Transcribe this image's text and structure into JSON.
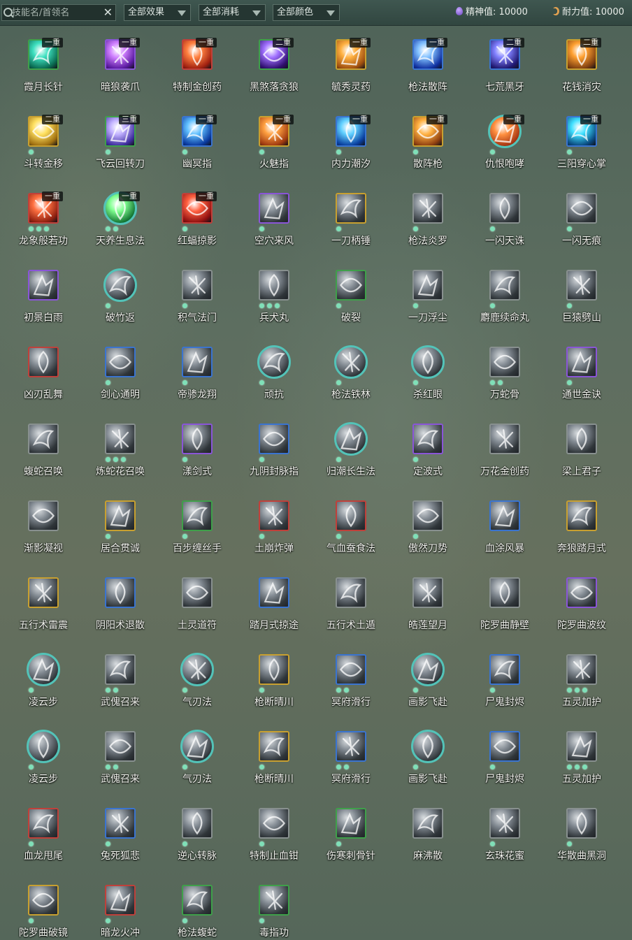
{
  "toolbar": {
    "search_placeholder": "技能名/首领名",
    "clear_icon": "✕",
    "filters": [
      {
        "label": "全部效果"
      },
      {
        "label": "全部消耗"
      },
      {
        "label": "全部颜色"
      }
    ],
    "stats": [
      {
        "text": "精神值: 10000",
        "icon": "spirit-drop-icon"
      },
      {
        "text": "耐力值: 10000",
        "icon": "stamina-moon-icon"
      }
    ]
  },
  "skills": [
    {
      "name": "霞月长针",
      "badge": "一重",
      "dots": 0,
      "frame": "c-green",
      "colors": [
        "#3ee0c0",
        "#0a6a50"
      ]
    },
    {
      "name": "暗狼袭爪",
      "badge": "一重",
      "dots": 0,
      "frame": "c-purple",
      "colors": [
        "#d080ff",
        "#5a1aa0"
      ]
    },
    {
      "name": "特制金创药",
      "badge": "一重",
      "dots": 0,
      "frame": "c-red",
      "colors": [
        "#ff8040",
        "#a02010"
      ]
    },
    {
      "name": "黑煞落贪狼",
      "badge": "二重",
      "dots": 0,
      "frame": "c-green",
      "colors": [
        "#a070ff",
        "#301070"
      ]
    },
    {
      "name": "毓秀灵药",
      "badge": "一重",
      "dots": 0,
      "frame": "c-gold",
      "colors": [
        "#ffb040",
        "#a05010"
      ]
    },
    {
      "name": "枪法散阵",
      "badge": "一重",
      "dots": 0,
      "frame": "c-blue",
      "colors": [
        "#80c0ff",
        "#1030a0"
      ]
    },
    {
      "name": "七荒黑牙",
      "badge": "二重",
      "dots": 0,
      "frame": "c-blue",
      "colors": [
        "#8080ff",
        "#201870"
      ]
    },
    {
      "name": "花钱消灾",
      "badge": "二重",
      "dots": 0,
      "frame": "c-gold",
      "colors": [
        "#ffa030",
        "#804010"
      ]
    },
    {
      "name": "斗转金移",
      "badge": "二重",
      "dots": 1,
      "frame": "c-gold",
      "colors": [
        "#ffe060",
        "#a07010"
      ]
    },
    {
      "name": "飞云回转刀",
      "badge": "三重",
      "dots": 1,
      "frame": "c-green",
      "colors": [
        "#c0b0ff",
        "#4030a0"
      ]
    },
    {
      "name": "幽冥指",
      "badge": "一重",
      "dots": 1,
      "frame": "c-blue",
      "colors": [
        "#60c0ff",
        "#0a3aa0"
      ]
    },
    {
      "name": "火魅指",
      "badge": "一重",
      "dots": 1,
      "frame": "c-gold",
      "colors": [
        "#ffa040",
        "#a03a10"
      ]
    },
    {
      "name": "内力潮汐",
      "badge": "一重",
      "dots": 1,
      "frame": "c-blue",
      "colors": [
        "#60d0ff",
        "#0a40a0"
      ]
    },
    {
      "name": "散阵枪",
      "badge": "一重",
      "dots": 1,
      "frame": "c-gold",
      "colors": [
        "#ffb040",
        "#904010"
      ]
    },
    {
      "name": "仇恨咆哮",
      "badge": "一重",
      "dots": 1,
      "frame": "c-teal",
      "round": true,
      "colors": [
        "#ff9040",
        "#a03010"
      ]
    },
    {
      "name": "三阳穿心掌",
      "badge": "一重",
      "dots": 1,
      "frame": "c-blue",
      "colors": [
        "#40e0ff",
        "#0a4a80"
      ]
    },
    {
      "name": "龙象般若功",
      "badge": "一重",
      "dots": 3,
      "frame": "c-red",
      "colors": [
        "#ff7040",
        "#902010"
      ]
    },
    {
      "name": "天养生息法",
      "badge": "一重",
      "dots": 2,
      "frame": "c-teal",
      "round": true,
      "colors": [
        "#80ff90",
        "#107030"
      ]
    },
    {
      "name": "红蝠掠影",
      "badge": "一重",
      "dots": 1,
      "frame": "c-red",
      "colors": [
        "#ff6040",
        "#901010"
      ]
    },
    {
      "name": "空穴来风",
      "dots": 1,
      "frame": "c-purple"
    },
    {
      "name": "一刀柄锤",
      "dots": 1,
      "frame": "c-gold"
    },
    {
      "name": "枪法炎罗",
      "dots": 1,
      "frame": "c-gray"
    },
    {
      "name": "一闪天诛",
      "dots": 1,
      "frame": "c-gray"
    },
    {
      "name": "一闪无痕",
      "dots": 1,
      "frame": "c-gray"
    },
    {
      "name": "初景白雨",
      "dots": 0,
      "frame": "c-purple"
    },
    {
      "name": "破竹返",
      "dots": 1,
      "frame": "c-teal",
      "round": true
    },
    {
      "name": "积气法门",
      "dots": 1,
      "frame": "c-gray"
    },
    {
      "name": "兵犬丸",
      "dots": 3,
      "frame": "c-gray"
    },
    {
      "name": "破裂",
      "dots": 1,
      "frame": "c-green"
    },
    {
      "name": "一刀浮尘",
      "dots": 1,
      "frame": "c-gray"
    },
    {
      "name": "麝鹿续命丸",
      "dots": 1,
      "frame": "c-gray"
    },
    {
      "name": "巨猿劈山",
      "dots": 1,
      "frame": "c-gray"
    },
    {
      "name": "凶刃乱舞",
      "dots": 0,
      "frame": "c-red"
    },
    {
      "name": "剑心通明",
      "dots": 1,
      "frame": "c-blue"
    },
    {
      "name": "帝骖龙翔",
      "dots": 1,
      "frame": "c-blue"
    },
    {
      "name": "顽抗",
      "dots": 1,
      "frame": "c-teal",
      "round": true
    },
    {
      "name": "枪法铁林",
      "dots": 1,
      "frame": "c-teal",
      "round": true
    },
    {
      "name": "杀红眼",
      "dots": 1,
      "frame": "c-teal",
      "round": true
    },
    {
      "name": "万蛇骨",
      "dots": 2,
      "frame": "c-gray"
    },
    {
      "name": "通世金诀",
      "dots": 1,
      "frame": "c-purple"
    },
    {
      "name": "蝮蛇召唤",
      "dots": 0,
      "frame": "c-gray"
    },
    {
      "name": "炼蛇花召唤",
      "dots": 3,
      "frame": "c-gray"
    },
    {
      "name": "漾剑式",
      "dots": 1,
      "frame": "c-purple"
    },
    {
      "name": "九阴封脉指",
      "dots": 1,
      "frame": "c-blue"
    },
    {
      "name": "归潮长生法",
      "dots": 1,
      "frame": "c-teal",
      "round": true
    },
    {
      "name": "定波式",
      "dots": 1,
      "frame": "c-purple"
    },
    {
      "name": "万花金创药",
      "dots": 0,
      "frame": "c-gray"
    },
    {
      "name": "梁上君子",
      "dots": 0,
      "frame": "c-gray"
    },
    {
      "name": "渐影凝视",
      "dots": 0,
      "frame": "c-gray"
    },
    {
      "name": "居合贯诚",
      "dots": 1,
      "frame": "c-gold"
    },
    {
      "name": "百步缠丝手",
      "dots": 1,
      "frame": "c-green"
    },
    {
      "name": "土崩炸弹",
      "dots": 1,
      "frame": "c-red"
    },
    {
      "name": "气血蚕食法",
      "dots": 1,
      "frame": "c-red"
    },
    {
      "name": "傲然刀势",
      "dots": 1,
      "frame": "c-gray"
    },
    {
      "name": "血涂风暴",
      "dots": 0,
      "frame": "c-blue"
    },
    {
      "name": "奔狼踏月式",
      "dots": 0,
      "frame": "c-gold"
    },
    {
      "name": "五行术雷震",
      "dots": 0,
      "frame": "c-gold"
    },
    {
      "name": "阴阳术退散",
      "dots": 0,
      "frame": "c-blue"
    },
    {
      "name": "土灵道符",
      "dots": 0,
      "frame": "c-gray"
    },
    {
      "name": "踏月式掠途",
      "dots": 0,
      "frame": "c-blue"
    },
    {
      "name": "五行术土遁",
      "dots": 0,
      "frame": "c-gray"
    },
    {
      "name": "皓莲望月",
      "dots": 0,
      "frame": "c-gray"
    },
    {
      "name": "陀罗曲静壁",
      "dots": 0,
      "frame": "c-gray"
    },
    {
      "name": "陀罗曲波纹",
      "dots": 0,
      "frame": "c-purple"
    },
    {
      "name": "凌云步",
      "dots": 1,
      "frame": "c-teal",
      "round": true
    },
    {
      "name": "武傀召来",
      "dots": 2,
      "frame": "c-gray"
    },
    {
      "name": "气刃法",
      "dots": 1,
      "frame": "c-teal",
      "round": true
    },
    {
      "name": "枪断晴川",
      "dots": 1,
      "frame": "c-gold"
    },
    {
      "name": "冥府滑行",
      "dots": 2,
      "frame": "c-blue"
    },
    {
      "name": "画影飞赴",
      "dots": 1,
      "frame": "c-teal",
      "round": true
    },
    {
      "name": "尸鬼封烬",
      "dots": 1,
      "frame": "c-blue"
    },
    {
      "name": "五灵加护",
      "dots": 3,
      "frame": "c-gray"
    },
    {
      "name": "凌云步",
      "dots": 1,
      "frame": "c-teal",
      "round": true
    },
    {
      "name": "武傀召来",
      "dots": 2,
      "frame": "c-gray"
    },
    {
      "name": "气刃法",
      "dots": 1,
      "frame": "c-teal",
      "round": true
    },
    {
      "name": "枪断晴川",
      "dots": 1,
      "frame": "c-gold"
    },
    {
      "name": "冥府滑行",
      "dots": 2,
      "frame": "c-blue"
    },
    {
      "name": "画影飞赴",
      "dots": 1,
      "frame": "c-teal",
      "round": true
    },
    {
      "name": "尸鬼封烬",
      "dots": 1,
      "frame": "c-blue"
    },
    {
      "name": "五灵加护",
      "dots": 3,
      "frame": "c-gray"
    },
    {
      "name": "血龙甩尾",
      "dots": 1,
      "frame": "c-red"
    },
    {
      "name": "兔死狐悲",
      "dots": 1,
      "frame": "c-blue"
    },
    {
      "name": "逆心转脉",
      "dots": 1,
      "frame": "c-gray"
    },
    {
      "name": "特制止血钳",
      "dots": 1,
      "frame": "c-gray"
    },
    {
      "name": "伤寒刺骨针",
      "dots": 1,
      "frame": "c-green"
    },
    {
      "name": "麻沸散",
      "dots": 0,
      "frame": "c-gray"
    },
    {
      "name": "玄珠花蜜",
      "dots": 1,
      "frame": "c-gray"
    },
    {
      "name": "华散曲黑洞",
      "dots": 1,
      "frame": "c-gray"
    },
    {
      "name": "陀罗曲破镜",
      "dots": 1,
      "frame": "c-gold"
    },
    {
      "name": "暗龙火冲",
      "dots": 1,
      "frame": "c-red"
    },
    {
      "name": "枪法蝮蛇",
      "dots": 1,
      "frame": "c-green"
    },
    {
      "name": "毒指功",
      "dots": 1,
      "frame": "c-green"
    }
  ]
}
